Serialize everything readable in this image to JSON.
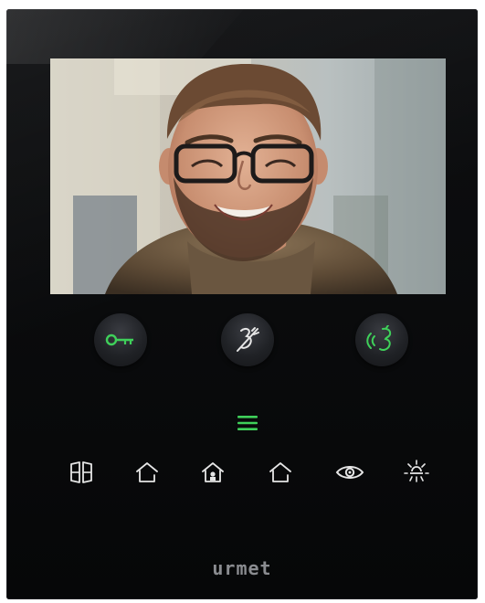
{
  "device": {
    "brand": "urmet",
    "screen_content": "video-call-visitor",
    "accent_color": "#3fd05a",
    "icon_color": "#e6e6e6"
  },
  "call_buttons": [
    {
      "name": "door-key",
      "icon": "key-icon",
      "color": "#3fd05a"
    },
    {
      "name": "mute",
      "icon": "mute-icon",
      "color": "#e6e6e6"
    },
    {
      "name": "answer",
      "icon": "speak-icon",
      "color": "#3fd05a"
    }
  ],
  "menu": {
    "icon": "menu-icon",
    "color": "#3fd05a"
  },
  "function_buttons": [
    {
      "name": "gate",
      "icon": "gate-icon"
    },
    {
      "name": "home-1",
      "icon": "home-icon"
    },
    {
      "name": "home-camera",
      "icon": "home-camera-icon"
    },
    {
      "name": "home-2",
      "icon": "home-icon"
    },
    {
      "name": "watch",
      "icon": "eye-icon"
    },
    {
      "name": "light",
      "icon": "light-icon"
    }
  ]
}
